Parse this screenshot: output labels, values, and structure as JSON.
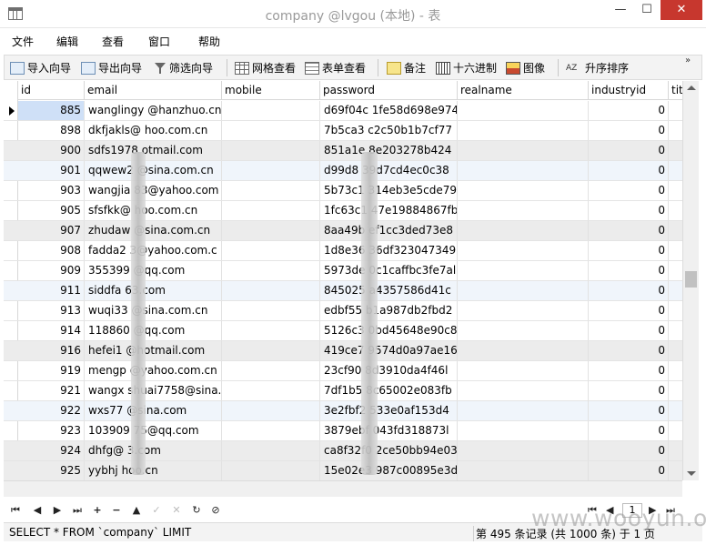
{
  "window": {
    "title": "company @lvgou (本地) - 表",
    "min_label": "—",
    "max_label": "☐",
    "close_label": "✕"
  },
  "menu": [
    "文件",
    "编辑",
    "查看",
    "窗口",
    "帮助"
  ],
  "toolbar": {
    "import": "导入向导",
    "export": "导出向导",
    "filter": "筛选向导",
    "grid_view": "网格查看",
    "form_view": "表单查看",
    "memo": "备注",
    "hex": "十六进制",
    "image": "图像",
    "sort": "升序排序",
    "sort_icon_text": "AZ",
    "more": "»"
  },
  "columns": [
    "id",
    "email",
    "mobile",
    "password",
    "realname",
    "industryid",
    "tit"
  ],
  "rows": [
    {
      "id": "885",
      "email": "wanglingy    @hanzhuo.cn",
      "password": "d69f04c    1fe58d698e974",
      "industryid": "0"
    },
    {
      "id": "898",
      "email": "dkfjakls@    hoo.com.cn",
      "password": "7b5ca3    c2c50b1b7cf77",
      "industryid": "0"
    },
    {
      "id": "900",
      "email": "sdfs1978    otmail.com",
      "password": "851a1e    8e203278b424",
      "industryid": "0"
    },
    {
      "id": "901",
      "email": "qqwew2    @sina.com.cn",
      "password": "d99d8    39d7cd4ec0c38",
      "industryid": "0"
    },
    {
      "id": "903",
      "email": "wangjia    83@yahoo.com",
      "password": "5b73c1    314eb3e5cde79",
      "industryid": "0"
    },
    {
      "id": "905",
      "email": "sfsfkk@    hoo.com.cn",
      "password": "1fc63c1    47e19884867fb",
      "industryid": "0"
    },
    {
      "id": "907",
      "email": "zhudaw    @sina.com.cn",
      "password": "8aa49b    ef1cc3ded73e8",
      "industryid": "0"
    },
    {
      "id": "908",
      "email": "fadda2    3@yahoo.com.c",
      "password": "1d8e36    36df323047349",
      "industryid": "0"
    },
    {
      "id": "909",
      "email": "355399    @qq.com",
      "password": "5973de    0c1caffbc3fe7al",
      "industryid": "0"
    },
    {
      "id": "911",
      "email": "siddfa    63.com",
      "password": "845025    a4357586d41c",
      "industryid": "0"
    },
    {
      "id": "913",
      "email": "wuqi33    @sina.com.cn",
      "password": "edbf55    b1a987db2fbd2",
      "industryid": "0"
    },
    {
      "id": "914",
      "email": "118860    @qq.com",
      "password": "5126c3    0bd45648e90c8",
      "industryid": "0"
    },
    {
      "id": "916",
      "email": "hefei1    @hotmail.com",
      "password": "419ce7    9574d0a97ae16",
      "industryid": "0"
    },
    {
      "id": "919",
      "email": "mengp    @yahoo.com.cn",
      "password": "23cf90    8d3910da4f46l",
      "industryid": "0"
    },
    {
      "id": "921",
      "email": "wangx    shuai7758@sina.",
      "password": "7df1b5    8c65002e083fb",
      "industryid": "0"
    },
    {
      "id": "922",
      "email": "wxs77    @sina.com",
      "password": "3e2fbf2    533e0af153d4",
      "industryid": "0"
    },
    {
      "id": "923",
      "email": "103909    75@qq.com",
      "password": "3879ebf    043fd318873l",
      "industryid": "0"
    },
    {
      "id": "924",
      "email": "dhfg@    3.com",
      "password": "ca8f32f0    2ce50bb94e03",
      "industryid": "0"
    },
    {
      "id": "925",
      "email": "yybhj    hoo.cn",
      "password": "15e02e3    987c00895e3d",
      "industryid": "0"
    }
  ],
  "nav": {
    "first": "⏮",
    "prev": "◀",
    "next": "▶",
    "last": "⏭",
    "add": "+",
    "delete": "−",
    "up": "▲",
    "apply": "✓",
    "cancel": "✕",
    "refresh": "↻",
    "stop": "⊘",
    "page": "1"
  },
  "status": {
    "sql": "SELECT * FROM `company` LIMIT",
    "records": "第 495 条记录 (共 1000 条) 于 1 页"
  },
  "watermark": "www.wooyun.org"
}
